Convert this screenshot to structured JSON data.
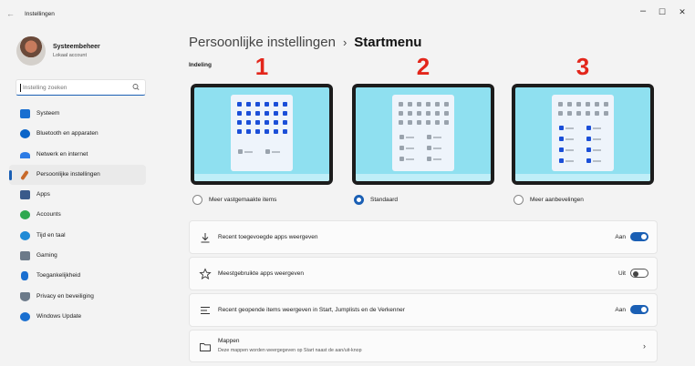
{
  "window": {
    "title": "Instellingen",
    "controls": {
      "minimize": "–",
      "maximize": "☐",
      "close": "✕"
    }
  },
  "profile": {
    "name": "Systeembeheer",
    "account": "Lokaal account"
  },
  "search": {
    "placeholder": "Instelling zoeken"
  },
  "sidebar": {
    "items": [
      {
        "label": "Systeem",
        "icon": "monitor-icon",
        "color": "#1a6fd0"
      },
      {
        "label": "Bluetooth en apparaten",
        "icon": "bluetooth-icon",
        "color": "#0a64c8"
      },
      {
        "label": "Netwerk en internet",
        "icon": "wifi-icon",
        "color": "#2c7be5"
      },
      {
        "label": "Persoonlijke instellingen",
        "icon": "brush-icon",
        "color": "#c86a2b",
        "active": true
      },
      {
        "label": "Apps",
        "icon": "apps-icon",
        "color": "#3a5a8a"
      },
      {
        "label": "Accounts",
        "icon": "person-icon",
        "color": "#2fa84f"
      },
      {
        "label": "Tijd en taal",
        "icon": "globe-clock-icon",
        "color": "#1f8ad6"
      },
      {
        "label": "Gaming",
        "icon": "gamepad-icon",
        "color": "#6c7a89"
      },
      {
        "label": "Toegankelijkheid",
        "icon": "accessibility-icon",
        "color": "#1a6fd0"
      },
      {
        "label": "Privacy en beveiliging",
        "icon": "shield-icon",
        "color": "#6c7a89"
      },
      {
        "label": "Windows Update",
        "icon": "update-icon",
        "color": "#1a6fd0"
      }
    ]
  },
  "breadcrumb": {
    "parent": "Persoonlijke instellingen",
    "separator": "›",
    "current": "Startmenu"
  },
  "layout": {
    "heading": "Indeling",
    "options": [
      {
        "number": "1",
        "label": "Meer vastgemaakte items",
        "selected": false
      },
      {
        "number": "2",
        "label": "Standaard",
        "selected": true
      },
      {
        "number": "3",
        "label": "Meer aanbevelingen",
        "selected": false
      }
    ]
  },
  "settings": [
    {
      "label": "Recent toegevoegde apps weergeven",
      "icon": "download-icon",
      "state": "Aan",
      "on": true
    },
    {
      "label": "Meestgebruikte apps weergeven",
      "icon": "star-icon",
      "state": "Uit",
      "on": false
    },
    {
      "label": "Recent geopende items weergeven in Start, Jumplists en de Verkenner",
      "icon": "list-icon",
      "state": "Aan",
      "on": true
    }
  ],
  "folders": {
    "title": "Mappen",
    "description": "Deze mappen worden weergegeven op Start naast de aan/uit-knop"
  },
  "colors": {
    "accent": "#1a5fb4",
    "annotation": "#e3261b",
    "preview_bg": "#8fe0f0"
  }
}
